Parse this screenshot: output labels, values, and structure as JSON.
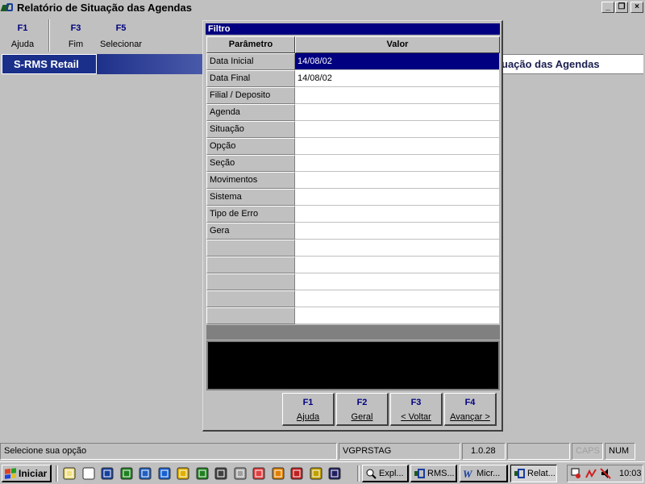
{
  "window": {
    "title": "Relatório de Situação das Agendas",
    "minimize_glyph": "_",
    "restore_glyph": "❐",
    "close_glyph": "×"
  },
  "toolbar": {
    "items": [
      {
        "key": "F1",
        "label": "Ajuda"
      },
      {
        "key": "F3",
        "label": "Fim"
      },
      {
        "key": "F5",
        "label": "Selecionar"
      }
    ]
  },
  "banner": {
    "brand": "S-RMS Retail",
    "report_title": "uação das Agendas"
  },
  "dialog": {
    "title": "Filtro",
    "columns": {
      "param": "Parâmetro",
      "value": "Valor"
    },
    "rows": [
      {
        "param": "Data Inicial",
        "value": "14/08/02",
        "selected": true
      },
      {
        "param": "Data Final",
        "value": "14/08/02"
      },
      {
        "param": "Filial / Deposito",
        "value": ""
      },
      {
        "param": "Agenda",
        "value": ""
      },
      {
        "param": "Situação",
        "value": ""
      },
      {
        "param": "Opção",
        "value": ""
      },
      {
        "param": "Seção",
        "value": ""
      },
      {
        "param": "Movimentos",
        "value": ""
      },
      {
        "param": "Sistema",
        "value": ""
      },
      {
        "param": "Tipo de Erro",
        "value": ""
      },
      {
        "param": "Gera",
        "value": ""
      },
      {
        "param": "",
        "value": ""
      },
      {
        "param": "",
        "value": ""
      },
      {
        "param": "",
        "value": ""
      },
      {
        "param": "",
        "value": ""
      },
      {
        "param": "",
        "value": ""
      }
    ],
    "buttons": [
      {
        "key": "F1",
        "label": "Ajuda"
      },
      {
        "key": "F2",
        "label": "Geral"
      },
      {
        "key": "F3",
        "label": "< Voltar"
      },
      {
        "key": "F4",
        "label": "Avançar >"
      }
    ]
  },
  "statusbar": {
    "message": "Selecione sua opção",
    "program": "VGPRSTAG",
    "version": "1.0.28",
    "empty": "",
    "caps": "CAPS",
    "num": "NUM"
  },
  "taskbar": {
    "start_label": "Iniciar",
    "quick_launch_icons": [
      "notepad-icon",
      "find-icon",
      "word-icon",
      "install-icon",
      "network-icon",
      "internet-explorer-icon",
      "download-icon",
      "grid-app-icon",
      "monitor-icon",
      "printer-icon",
      "chrome-ball-icon",
      "paint-icon",
      "antivirus-icon",
      "media-icon",
      "rms-icon"
    ],
    "tasks": [
      {
        "label": "Expl...",
        "icon": "explorer-icon"
      },
      {
        "label": "RMS...",
        "icon": "rms-icon"
      },
      {
        "label": "Micr...",
        "icon": "word-icon"
      },
      {
        "label": "Relat...",
        "icon": "rms-icon"
      }
    ],
    "clock": "10:03"
  },
  "colors": {
    "desktop": "#c0c0c0",
    "title_blue": "#000080",
    "banner_blue": "#1a2f8a",
    "selection": "#000080"
  }
}
